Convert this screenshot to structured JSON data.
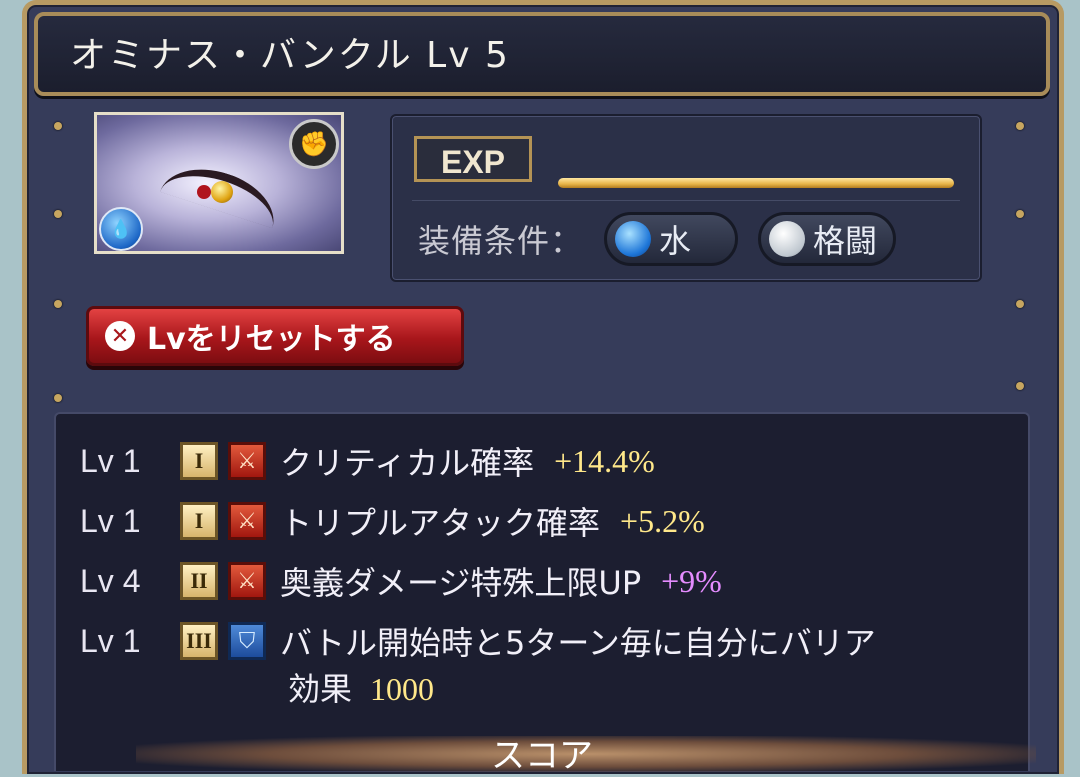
{
  "title": "オミナス・バンクル Lv 5",
  "item": {
    "element": "water",
    "weapon_type": "fist"
  },
  "exp": {
    "label": "EXP",
    "fill_fraction": 1.0
  },
  "equip_conditions": {
    "label": "装備条件：",
    "element_label": "水",
    "weapon_label": "格闘"
  },
  "reset_button": {
    "label": "Lvをリセットする"
  },
  "skills": [
    {
      "level": "Lv 1",
      "tier": "I",
      "type": "attack",
      "name": "クリティカル確率",
      "value": "+14.4%",
      "value_color": "gold"
    },
    {
      "level": "Lv 1",
      "tier": "I",
      "type": "attack",
      "name": "トリプルアタック確率",
      "value": "+5.2%",
      "value_color": "gold"
    },
    {
      "level": "Lv 4",
      "tier": "II",
      "type": "attack",
      "name": "奥義ダメージ特殊上限UP",
      "value": "+9%",
      "value_color": "purple"
    },
    {
      "level": "Lv 1",
      "tier": "III",
      "type": "defense",
      "name": "バトル開始時と5ターン毎に自分にバリア",
      "name_line2": "効果",
      "value": "1000",
      "value_color": "gold"
    }
  ],
  "score": {
    "label": "スコア"
  },
  "colors": {
    "frame_gold": "#b79a63",
    "value_gold": "#ffe88a",
    "value_purple": "#e58cff",
    "reset_red": "#a8161b"
  }
}
